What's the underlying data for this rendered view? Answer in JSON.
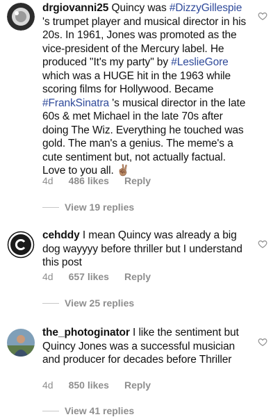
{
  "comments": [
    {
      "username": "drgiovanni25",
      "segments": [
        " Quincy was ",
        "#DizzyGillespie",
        " 's trumpet player and musical director in his 20s. In 1961, Jones was promoted as the vice-president of the Mercury label. He produced \"It's my party\" by ",
        "#LeslieGore",
        " which was a HUGE hit in the 1963 while scoring films for Hollywood. Became ",
        "#FrankSinatra",
        " 's musical director in the late 60s & met Michael in the late 70s after doing The Wiz. Everything he touched was gold. The man's a genius. The meme's a cute sentiment but, not actually factual. Love to you all. ",
        "✌🏽"
      ],
      "age": "4d",
      "likes": "486 likes",
      "reply": "Reply",
      "view_replies": "View 19 replies"
    },
    {
      "username": "cehddy",
      "segments": [
        " I mean Quincy was already a big dog wayyyy before thriller but I understand this post"
      ],
      "age": "4d",
      "likes": "657 likes",
      "reply": "Reply",
      "view_replies": "View 25 replies"
    },
    {
      "username": "the_photoginator",
      "segments": [
        " I like the sentiment but Quincy Jones was a successful musician and producer for decades before Thriller"
      ],
      "age": "4d",
      "likes": "850 likes",
      "reply": "Reply",
      "view_replies": "View 41 replies"
    }
  ],
  "colors": {
    "hashtag": "#2f4a9a",
    "meta": "#8e8e8e"
  },
  "icons": {
    "like": "heart-outline-icon"
  }
}
